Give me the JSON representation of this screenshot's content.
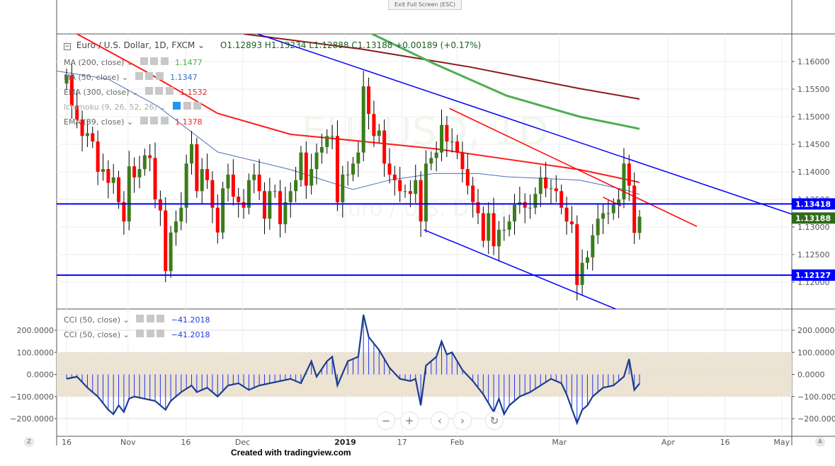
{
  "top": {
    "exit_fullscreen": "Exit Full Screen (ESC)"
  },
  "header": {
    "symbol": "Euro / U.S. Dollar, 1D, FXCM",
    "ohlc": "O1.12893 H1.13234 L1.12888 C1.13188 +0.00189 (+0.17%)"
  },
  "watermark": {
    "line1": "EURUSD, 1D",
    "line2": "Euro / U.S. Dollar"
  },
  "indicators": [
    {
      "label": "MA (200, close)",
      "value": "1.1477",
      "color": "#4caf50"
    },
    {
      "label": "MA (50, close)",
      "value": "1.1347",
      "color": "#3d6fc6"
    },
    {
      "label": "EMA (300, close)",
      "value": "1.1532",
      "color": "#d32f2f"
    },
    {
      "label": "Ichimoku (9, 26, 52, 26)",
      "value": "",
      "color": "#aaaaaa"
    },
    {
      "label": "EMA (89, close)",
      "value": "1.1378",
      "color": "#ff2222"
    }
  ],
  "cci_legends": [
    {
      "label": "CCI (50, close)",
      "value": "−41.2018"
    },
    {
      "label": "CCI (50, close)",
      "value": "−41.2018"
    }
  ],
  "nav": {
    "zoom_out": "−",
    "zoom_in": "+",
    "left": "‹",
    "right": "›",
    "reset": "↻"
  },
  "corner": {
    "left": "Z",
    "right": "A"
  },
  "footer": "Created with tradingview.com",
  "chart_data": {
    "type": "candlestick",
    "price_ticks": [
      "1.16000",
      "1.15500",
      "1.15000",
      "1.14500",
      "1.14000",
      "1.13500",
      "1.13000",
      "1.12500",
      "1.12000"
    ],
    "price_values": [
      1.16,
      1.155,
      1.15,
      1.145,
      1.14,
      1.135,
      1.13,
      1.125,
      1.12
    ],
    "x_ticks": [
      {
        "label": "16",
        "bar": 0
      },
      {
        "label": "Nov",
        "bar": 11.8
      },
      {
        "label": "16",
        "bar": 22.9
      },
      {
        "label": "Dec",
        "bar": 33.8
      },
      {
        "label": "2019",
        "bar": 53.5
      },
      {
        "label": "17",
        "bar": 64.4
      },
      {
        "label": "Feb",
        "bar": 75
      },
      {
        "label": "Mar",
        "bar": 94.6
      },
      {
        "label": "Apr",
        "bar": 115.5
      },
      {
        "label": "16",
        "bar": 126.4
      },
      {
        "label": "May",
        "bar": 137.3
      }
    ],
    "closes": [
      1.1575,
      1.152,
      1.1495,
      1.1465,
      1.147,
      1.1455,
      1.14,
      1.1405,
      1.138,
      1.139,
      1.1345,
      1.131,
      1.141,
      1.139,
      1.1405,
      1.143,
      1.1425,
      1.135,
      1.133,
      1.122,
      1.129,
      1.131,
      1.1335,
      1.1415,
      1.145,
      1.1365,
      1.1405,
      1.1385,
      1.1335,
      1.129,
      1.137,
      1.1395,
      1.1355,
      1.1345,
      1.1335,
      1.1385,
      1.1395,
      1.1365,
      1.1315,
      1.1365,
      1.1365,
      1.1305,
      1.1345,
      1.1365,
      1.1385,
      1.1435,
      1.1375,
      1.1405,
      1.1435,
      1.1445,
      1.1465,
      1.1465,
      1.1345,
      1.1395,
      1.1395,
      1.1415,
      1.1435,
      1.1555,
      1.1505,
      1.1465,
      1.1475,
      1.1415,
      1.1395,
      1.1385,
      1.1365,
      1.1365,
      1.136,
      1.1385,
      1.131,
      1.1415,
      1.1425,
      1.1435,
      1.1485,
      1.1455,
      1.1455,
      1.1435,
      1.1405,
      1.1375,
      1.1345,
      1.1325,
      1.1275,
      1.1325,
      1.1265,
      1.1295,
      1.1295,
      1.131,
      1.134,
      1.1345,
      1.1335,
      1.1335,
      1.136,
      1.139,
      1.137,
      1.137,
      1.1365,
      1.1335,
      1.131,
      1.1305,
      1.1195,
      1.1235,
      1.1245,
      1.1285,
      1.1315,
      1.1325,
      1.1325,
      1.134,
      1.135,
      1.1415,
      1.1375,
      1.12893,
      1.13188
    ],
    "ma200": [
      [
        58,
        1.1653
      ],
      [
        70.6,
        1.1596
      ],
      [
        84.5,
        1.1538
      ],
      [
        98.5,
        1.15
      ],
      [
        110,
        1.1478
      ]
    ],
    "ema300": [
      [
        34,
        1.165
      ],
      [
        57,
        1.1622
      ],
      [
        77.5,
        1.159
      ],
      [
        98.5,
        1.1551
      ],
      [
        110,
        1.1532
      ]
    ],
    "ema89": [
      [
        2,
        1.165
      ],
      [
        15,
        1.1583
      ],
      [
        29,
        1.1506
      ],
      [
        43,
        1.1468
      ],
      [
        57,
        1.1455
      ],
      [
        70.6,
        1.1442
      ],
      [
        84.5,
        1.1423
      ],
      [
        98.5,
        1.1404
      ],
      [
        110,
        1.1381
      ]
    ],
    "ma50": [
      [
        -2,
        1.1583
      ],
      [
        8,
        1.1568
      ],
      [
        17.5,
        1.1519
      ],
      [
        29,
        1.1436
      ],
      [
        43,
        1.1404
      ],
      [
        55,
        1.1368
      ],
      [
        62,
        1.1385
      ],
      [
        70.6,
        1.1397
      ],
      [
        79,
        1.1397
      ],
      [
        84.5,
        1.1391
      ],
      [
        98.5,
        1.1385
      ],
      [
        107,
        1.1368
      ],
      [
        110,
        1.1359
      ]
    ],
    "trendlines": [
      {
        "color": "#0000ff",
        "points": [
          [
            36.7,
            1.165
          ],
          [
            142.8,
            1.1312
          ]
        ]
      },
      {
        "color": "#0000ff",
        "points": [
          [
            68.6,
            1.1295
          ],
          [
            105.5,
            1.1151
          ]
        ]
      },
      {
        "color": "#ff0000",
        "points": [
          [
            73.5,
            1.1515
          ],
          [
            121,
            1.1301
          ]
        ]
      },
      {
        "color": "#ff0000",
        "points": [
          [
            103,
            1.1354
          ],
          [
            106.5,
            1.1338
          ]
        ]
      }
    ],
    "hlines": [
      {
        "value": 1.13418,
        "label": "1.13418",
        "color": "#0000ff"
      },
      {
        "value": 1.12127,
        "label": "1.12127",
        "color": "#0000ff"
      }
    ],
    "last_price": {
      "value": 1.13188,
      "label": "1.13188",
      "color": "#2e6b1b"
    },
    "cci_ticks": [
      "200.0000",
      "100.0000",
      "0.0000",
      "−100.0000",
      "−200.0000"
    ],
    "cci_tick_values": [
      200,
      100,
      0,
      -100,
      -200
    ],
    "cci_band": [
      -100,
      100
    ],
    "cci": [
      [
        0,
        -20
      ],
      [
        2,
        -10
      ],
      [
        4,
        -60
      ],
      [
        6,
        -100
      ],
      [
        8,
        -160
      ],
      [
        9,
        -180
      ],
      [
        10,
        -140
      ],
      [
        11,
        -170
      ],
      [
        12,
        -110
      ],
      [
        13,
        -100
      ],
      [
        15,
        -110
      ],
      [
        17,
        -120
      ],
      [
        19,
        -160
      ],
      [
        20,
        -120
      ],
      [
        22,
        -80
      ],
      [
        24,
        -50
      ],
      [
        25,
        -80
      ],
      [
        27,
        -60
      ],
      [
        29,
        -100
      ],
      [
        31,
        -50
      ],
      [
        33,
        -40
      ],
      [
        35,
        -70
      ],
      [
        37,
        -50
      ],
      [
        39,
        -40
      ],
      [
        41,
        -30
      ],
      [
        43,
        -20
      ],
      [
        45,
        -40
      ],
      [
        47,
        60
      ],
      [
        48,
        -10
      ],
      [
        50,
        60
      ],
      [
        51,
        80
      ],
      [
        52,
        -50
      ],
      [
        54,
        60
      ],
      [
        56,
        80
      ],
      [
        57,
        270
      ],
      [
        58,
        170
      ],
      [
        59,
        140
      ],
      [
        60,
        110
      ],
      [
        62,
        30
      ],
      [
        64,
        -20
      ],
      [
        66,
        -30
      ],
      [
        67,
        -20
      ],
      [
        68,
        -140
      ],
      [
        69,
        40
      ],
      [
        71,
        80
      ],
      [
        72,
        150
      ],
      [
        73,
        90
      ],
      [
        74,
        100
      ],
      [
        76,
        20
      ],
      [
        78,
        -30
      ],
      [
        80,
        -90
      ],
      [
        82,
        -170
      ],
      [
        83,
        -110
      ],
      [
        84,
        -180
      ],
      [
        85,
        -140
      ],
      [
        87,
        -100
      ],
      [
        89,
        -80
      ],
      [
        91,
        -50
      ],
      [
        93,
        -20
      ],
      [
        95,
        -40
      ],
      [
        96,
        -90
      ],
      [
        98,
        -220
      ],
      [
        99,
        -160
      ],
      [
        100,
        -140
      ],
      [
        101,
        -100
      ],
      [
        103,
        -60
      ],
      [
        105,
        -50
      ],
      [
        107,
        -10
      ],
      [
        108,
        70
      ],
      [
        109,
        -70
      ],
      [
        110,
        -41.2
      ]
    ]
  }
}
